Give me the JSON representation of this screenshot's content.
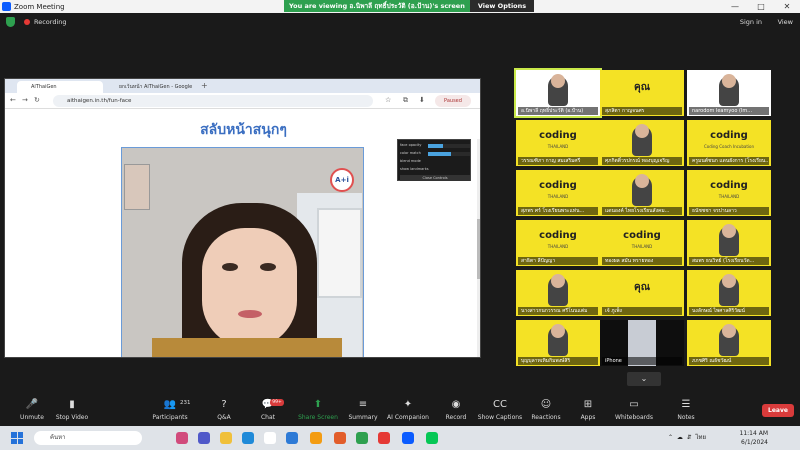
{
  "window": {
    "title": "Zoom Meeting",
    "controls": [
      "—",
      "□",
      "✕"
    ]
  },
  "banner": {
    "message": "You are viewing อ.นิพาลี ฤทธิ์ประวัติ (อ.ป้าน)'s screen",
    "view_options": "View Options"
  },
  "topbar": {
    "recording": "Recording",
    "sign_in": "Sign in",
    "view": "View"
  },
  "browser": {
    "tabs": [
      "AiThaiGen",
      "ยกเว้นหน้า AiThaiGen - Google"
    ],
    "url": "aithaigen.in.th/fun-face",
    "paused": "Paused",
    "page_title": "สลับหน้าสนุกๆ",
    "logo_text": "A+i",
    "controls_panel": {
      "rows": [
        {
          "label": "face opacity",
          "level": 0.35
        },
        {
          "label": "color match",
          "level": 0.55
        },
        {
          "label": "blend mode",
          "level": 0
        },
        {
          "label": "show landmarks",
          "level": 0
        }
      ],
      "close_label": "Close Controls"
    }
  },
  "gallery": {
    "tiles": [
      {
        "name": "อ.นิพาลี ฤทธิ์ประวัติ (อ.ป้าน)",
        "style": "white",
        "active": true
      },
      {
        "name": "สุภสิตา กาญจนศร",
        "style": "yellow-logo",
        "logo": "คุณ"
      },
      {
        "name": "narodom leamyoo (Im...",
        "style": "white-person"
      },
      {
        "name": "วรรณฑิภา กาญ สมเสริมศรี",
        "style": "yellow-logo",
        "logo": "coding",
        "sub": "THAILAND"
      },
      {
        "name": "ศุภกิตติ์วรปกรณ์ ทองบุญเจริญ",
        "style": "yellow-person"
      },
      {
        "name": "ครูมนต์ชนก แดนยังการ (โรงเรียน...",
        "style": "yellow-logo",
        "logo": "coding",
        "sub": "Coding Coach Incubation"
      },
      {
        "name": "สุภพร ศร์ โรงเรียนพระแท่น...",
        "style": "yellow-logo",
        "logo": "coding",
        "sub": "THAILAND"
      },
      {
        "name": "แดนองค์ ไทยโรงเรียนสังคม...",
        "style": "yellow-person"
      },
      {
        "name": "ธนัชชชา จรปานลาว",
        "style": "yellow-logo",
        "logo": "coding",
        "sub": "THAILAND"
      },
      {
        "name": "สาธิตา ลีปัญญา",
        "style": "yellow-logo",
        "logo": "coding",
        "sub": "THAILAND"
      },
      {
        "name": "ทองผล สมัน ทรายทอง",
        "style": "yellow-logo",
        "logo": "coding",
        "sub": "THAILAND"
      },
      {
        "name": "สมพร ธนวิทย์ (โรงเรียนวัด...",
        "style": "yellow-person"
      },
      {
        "name": "นางสาวกนกวรรณ ศรีโนนแต่ม",
        "style": "yellow-person"
      },
      {
        "name": "เจ้ ภูเพ็ง",
        "style": "yellow-logo",
        "logo": "คุณ"
      },
      {
        "name": "นงลักษณ์ ไพศาลศิริวัฒน์",
        "style": "yellow-person"
      },
      {
        "name": "บุญบุลาทเทิมกิมพงษ์สิริ",
        "style": "yellow-person"
      },
      {
        "name": "iPhone",
        "style": "dark"
      },
      {
        "name": "ภภชศิริ ณธัชวัฒน์",
        "style": "yellow-person"
      }
    ],
    "scroll_down": "⌄"
  },
  "toolbar": {
    "items": [
      {
        "label": "Unmute",
        "icon": "microphone-muted-icon",
        "glyph": "🎤"
      },
      {
        "label": "Stop Video",
        "icon": "video-camera-icon",
        "glyph": "▮"
      },
      {
        "label": "Participants",
        "icon": "participants-icon",
        "glyph": "👥",
        "count": "231"
      },
      {
        "label": "Q&A",
        "icon": "qa-icon",
        "glyph": "?"
      },
      {
        "label": "Chat",
        "icon": "chat-icon",
        "glyph": "💬",
        "badge": "99+"
      },
      {
        "label": "Share Screen",
        "icon": "share-screen-icon",
        "glyph": "⬆"
      },
      {
        "label": "Summary",
        "icon": "summary-icon",
        "glyph": "≡"
      },
      {
        "label": "AI Companion",
        "icon": "ai-companion-icon",
        "glyph": "✦"
      },
      {
        "label": "Record",
        "icon": "record-icon",
        "glyph": "◉"
      },
      {
        "label": "Show Captions",
        "icon": "captions-icon",
        "glyph": "CC"
      },
      {
        "label": "Reactions",
        "icon": "reactions-icon",
        "glyph": "☺"
      },
      {
        "label": "Apps",
        "icon": "apps-icon",
        "glyph": "⊞"
      },
      {
        "label": "Whiteboards",
        "icon": "whiteboard-icon",
        "glyph": "▭"
      },
      {
        "label": "Notes",
        "icon": "notes-icon",
        "glyph": "☰"
      }
    ],
    "leave": "Leave"
  },
  "taskbar": {
    "search_placeholder": "ค้นหา",
    "language": "ไทย",
    "time": "11:14 AM",
    "date": "6/1/2024"
  },
  "colors": {
    "zoom_blue": "#0b5cff",
    "share_green": "#2ea04f",
    "tile_yellow": "#f4e225",
    "leave_red": "#d93b3b"
  }
}
